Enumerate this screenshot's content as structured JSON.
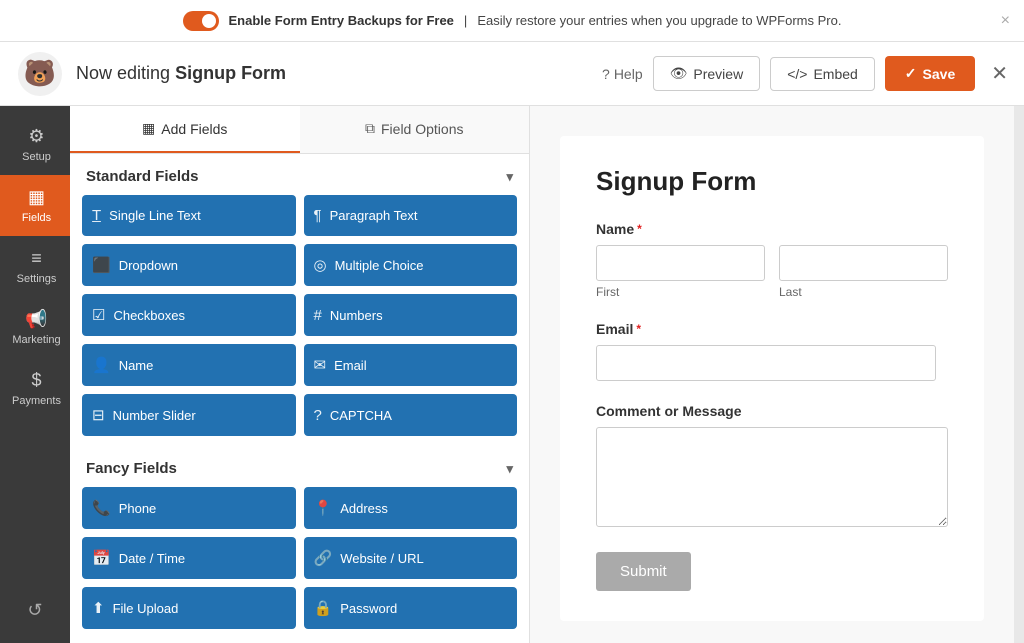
{
  "notif": {
    "text": "Enable Form Entry Backups for Free",
    "sub": "Easily restore your entries when you upgrade to WPForms Pro.",
    "close_icon": "×"
  },
  "header": {
    "editing_prefix": "Now editing",
    "form_name": "Signup Form",
    "help_label": "Help",
    "preview_label": "Preview",
    "embed_label": "Embed",
    "save_label": "Save",
    "close_icon": "✕"
  },
  "sidebar": {
    "items": [
      {
        "id": "setup",
        "label": "Setup",
        "icon": "⚙"
      },
      {
        "id": "fields",
        "label": "Fields",
        "icon": "▦",
        "active": true
      },
      {
        "id": "settings",
        "label": "Settings",
        "icon": "⧉"
      },
      {
        "id": "marketing",
        "label": "Marketing",
        "icon": "📢"
      },
      {
        "id": "payments",
        "label": "Payments",
        "icon": "$"
      }
    ],
    "undo_icon": "↺"
  },
  "panel": {
    "tab_add": "Add Fields",
    "tab_options": "Field Options",
    "sections": [
      {
        "id": "standard",
        "label": "Standard Fields",
        "fields": [
          {
            "id": "single-line",
            "label": "Single Line Text",
            "icon": "T"
          },
          {
            "id": "paragraph",
            "label": "Paragraph Text",
            "icon": "¶"
          },
          {
            "id": "dropdown",
            "label": "Dropdown",
            "icon": "⬛"
          },
          {
            "id": "multiple-choice",
            "label": "Multiple Choice",
            "icon": "◎"
          },
          {
            "id": "checkboxes",
            "label": "Checkboxes",
            "icon": "☑"
          },
          {
            "id": "numbers",
            "label": "Numbers",
            "icon": "#"
          },
          {
            "id": "name",
            "label": "Name",
            "icon": "👤"
          },
          {
            "id": "email",
            "label": "Email",
            "icon": "✉"
          },
          {
            "id": "number-slider",
            "label": "Number Slider",
            "icon": "⊟"
          },
          {
            "id": "captcha",
            "label": "CAPTCHA",
            "icon": "?"
          }
        ]
      },
      {
        "id": "fancy",
        "label": "Fancy Fields",
        "fields": [
          {
            "id": "phone",
            "label": "Phone",
            "icon": "📞"
          },
          {
            "id": "address",
            "label": "Address",
            "icon": "📍"
          },
          {
            "id": "date-time",
            "label": "Date / Time",
            "icon": "📅"
          },
          {
            "id": "website-url",
            "label": "Website / URL",
            "icon": "🔗"
          },
          {
            "id": "file-upload",
            "label": "File Upload",
            "icon": "⬆"
          },
          {
            "id": "password",
            "label": "Password",
            "icon": "🔒"
          }
        ]
      }
    ]
  },
  "form": {
    "title": "Signup Form",
    "fields": [
      {
        "id": "name",
        "label": "Name",
        "required": true,
        "type": "name",
        "subfields": [
          "First",
          "Last"
        ]
      },
      {
        "id": "email",
        "label": "Email",
        "required": true,
        "type": "text"
      },
      {
        "id": "comment",
        "label": "Comment or Message",
        "required": false,
        "type": "textarea"
      }
    ],
    "submit_label": "Submit"
  }
}
